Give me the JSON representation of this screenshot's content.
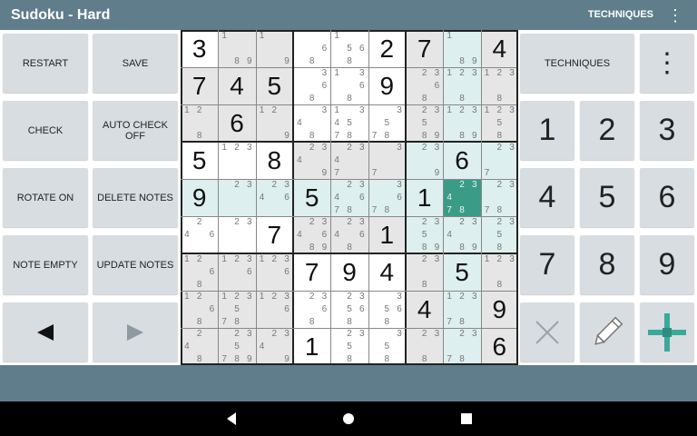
{
  "app": {
    "title": "Sudoku - Hard"
  },
  "topbar": {
    "techniques_label": "TECHNIQUES",
    "menu_icon": "overflow-menu-icon"
  },
  "left_buttons": [
    {
      "label": "RESTART"
    },
    {
      "label": "SAVE"
    },
    {
      "label": "CHECK"
    },
    {
      "label": "AUTO CHECK OFF"
    },
    {
      "label": "ROTATE ON"
    },
    {
      "label": "DELETE NOTES"
    },
    {
      "label": "NOTE EMPTY"
    },
    {
      "label": "UPDATE NOTES"
    }
  ],
  "nav_buttons": {
    "prev_icon": "arrow-left-icon",
    "next_icon": "arrow-right-icon"
  },
  "right_panel": {
    "techniques_label": "TECHNIQUES",
    "menu_icon": "overflow-menu-icon",
    "number_buttons": [
      "1",
      "2",
      "3",
      "4",
      "5",
      "6",
      "7",
      "8",
      "9"
    ],
    "tools": [
      "clear-icon",
      "pencil-icon",
      "crosshair-icon"
    ]
  },
  "colors": {
    "header": "#607d8b",
    "button": "#d7dde0",
    "cell_gray": "#e6e6e6",
    "cell_teal": "#ddefee",
    "cell_selected": "#3a9c86",
    "crosshair": "#3aa99b"
  },
  "grid": {
    "values": [
      [
        "3",
        "",
        "",
        "",
        "",
        "2",
        "7",
        "",
        "4"
      ],
      [
        "7",
        "4",
        "5",
        "",
        "",
        "9",
        "",
        "",
        ""
      ],
      [
        "",
        "6",
        "",
        "",
        "",
        "",
        "",
        "",
        ""
      ],
      [
        "5",
        "",
        "8",
        "",
        "",
        "",
        "",
        "6",
        ""
      ],
      [
        "9",
        "",
        "",
        "5",
        "",
        "",
        "1",
        "",
        ""
      ],
      [
        "",
        "",
        "7",
        "",
        "",
        "1",
        "",
        "",
        ""
      ],
      [
        "",
        "",
        "",
        "7",
        "9",
        "4",
        "",
        "5",
        ""
      ],
      [
        "",
        "",
        "",
        "",
        "",
        "",
        "4",
        "",
        "9"
      ],
      [
        "",
        "",
        "",
        "1",
        "",
        "",
        "",
        "",
        "6"
      ]
    ],
    "notes": [
      [
        [],
        [
          "1",
          "",
          "",
          "",
          "",
          "",
          "",
          "8",
          "9"
        ],
        [
          "1",
          "",
          "",
          "",
          "",
          "",
          "",
          "",
          "9"
        ],
        [
          "",
          "",
          "",
          "",
          "",
          "6",
          "",
          "8",
          ""
        ],
        [
          "1",
          "",
          "",
          "",
          "5",
          "6",
          "",
          "8",
          ""
        ],
        [],
        [],
        [
          "1",
          "",
          "",
          "",
          "",
          "",
          "",
          "8",
          "9"
        ],
        []
      ],
      [
        [],
        [],
        [],
        [
          "",
          "",
          "3",
          "",
          "",
          "6",
          "",
          "8",
          ""
        ],
        [
          "1",
          "",
          "3",
          "",
          "",
          "6",
          "",
          "8",
          ""
        ],
        [],
        [
          "",
          "2",
          "3",
          "",
          "",
          "6",
          "",
          "8",
          ""
        ],
        [
          "1",
          "2",
          "3",
          "",
          "",
          "",
          "",
          "8",
          ""
        ],
        [
          "1",
          "2",
          "3",
          "",
          "",
          "",
          "",
          "8",
          ""
        ]
      ],
      [
        [
          "1",
          "2",
          "",
          "",
          "",
          "",
          "",
          "8",
          ""
        ],
        [],
        [
          "1",
          "2",
          "",
          "",
          "",
          "",
          "",
          "",
          "9"
        ],
        [
          "",
          "",
          "3",
          "4",
          "",
          "",
          "",
          "8",
          ""
        ],
        [
          "1",
          "",
          "3",
          "4",
          "5",
          "",
          "7",
          "8",
          ""
        ],
        [
          "",
          "",
          "3",
          "",
          "5",
          "",
          "7",
          "8",
          ""
        ],
        [
          "",
          "2",
          "3",
          "",
          "5",
          "",
          "",
          "8",
          "9"
        ],
        [
          "1",
          "2",
          "3",
          "",
          "",
          "",
          "",
          "8",
          "9"
        ],
        [
          "1",
          "2",
          "3",
          "",
          "5",
          "",
          "",
          "8",
          ""
        ]
      ],
      [
        [],
        [
          "1",
          "2",
          "3",
          "",
          "",
          "",
          "",
          "",
          ""
        ],
        [],
        [
          "",
          "2",
          "3",
          "4",
          "",
          "",
          "",
          "",
          "9"
        ],
        [
          "",
          "2",
          "3",
          "4",
          "",
          "",
          "7",
          "",
          ""
        ],
        [
          "",
          "",
          "3",
          "",
          "",
          "",
          "7",
          "",
          ""
        ],
        [
          "",
          "2",
          "3",
          "",
          "",
          "",
          "",
          "",
          "9"
        ],
        [],
        [
          "",
          "2",
          "3",
          "",
          "",
          "",
          "7",
          "",
          ""
        ]
      ],
      [
        [],
        [
          "",
          "2",
          "3",
          "",
          "",
          "",
          "",
          "",
          ""
        ],
        [
          "",
          "2",
          "3",
          "4",
          "",
          "6",
          "",
          "",
          ""
        ],
        [],
        [
          "",
          "2",
          "3",
          "4",
          "",
          "6",
          "7",
          "8",
          ""
        ],
        [
          "",
          "",
          "3",
          "",
          "",
          "6",
          "7",
          "8",
          ""
        ],
        [],
        [
          "",
          "2",
          "3",
          "4",
          "",
          "",
          "7",
          "8",
          ""
        ],
        [
          "",
          "2",
          "3",
          "",
          "",
          "",
          "7",
          "8",
          ""
        ]
      ],
      [
        [
          "",
          "2",
          "",
          "4",
          "",
          "6",
          "",
          "",
          ""
        ],
        [
          "",
          "2",
          "3",
          "",
          "",
          "",
          "",
          "",
          ""
        ],
        [],
        [
          "",
          "2",
          "3",
          "4",
          "",
          "6",
          "",
          "8",
          "9"
        ],
        [
          "",
          "2",
          "3",
          "4",
          "",
          "6",
          "",
          "8",
          ""
        ],
        [],
        [
          "",
          "2",
          "3",
          "",
          "5",
          "",
          "",
          "8",
          "9"
        ],
        [
          "",
          "2",
          "3",
          "4",
          "",
          "",
          "",
          "8",
          "9"
        ],
        [
          "",
          "2",
          "3",
          "",
          "5",
          "",
          "",
          "8",
          ""
        ]
      ],
      [
        [
          "1",
          "2",
          "",
          "",
          "",
          "6",
          "",
          "8",
          ""
        ],
        [
          "1",
          "2",
          "3",
          "",
          "",
          "6",
          "",
          "",
          ""
        ],
        [
          "1",
          "2",
          "3",
          "",
          "",
          "6",
          "",
          "",
          ""
        ],
        [],
        [],
        [],
        [
          "",
          "2",
          "3",
          "",
          "",
          "",
          "",
          "8",
          ""
        ],
        [],
        [
          "1",
          "2",
          "3",
          "",
          "",
          "",
          "",
          "8",
          ""
        ]
      ],
      [
        [
          "1",
          "2",
          "",
          "",
          "",
          "6",
          "",
          "8",
          ""
        ],
        [
          "1",
          "2",
          "3",
          "",
          "5",
          "",
          "7",
          "8",
          ""
        ],
        [
          "1",
          "2",
          "3",
          "",
          "",
          "6",
          "",
          "",
          ""
        ],
        [
          "",
          "2",
          "3",
          "",
          "",
          "6",
          "",
          "8",
          ""
        ],
        [
          "",
          "2",
          "3",
          "",
          "5",
          "6",
          "",
          "8",
          ""
        ],
        [
          "",
          "",
          "3",
          "",
          "5",
          "6",
          "",
          "8",
          ""
        ],
        [],
        [
          "1",
          "2",
          "3",
          "",
          "",
          "",
          "7",
          "8",
          ""
        ],
        []
      ],
      [
        [
          "",
          "2",
          "",
          "4",
          "",
          "",
          "",
          "8",
          ""
        ],
        [
          "",
          "2",
          "3",
          "",
          "5",
          "",
          "7",
          "8",
          "9"
        ],
        [
          "",
          "2",
          "3",
          "4",
          "",
          "",
          "",
          "",
          "9"
        ],
        [],
        [
          "",
          "2",
          "3",
          "",
          "5",
          "",
          "",
          "8",
          ""
        ],
        [
          "",
          "",
          "3",
          "",
          "5",
          "",
          "",
          "8",
          ""
        ],
        [
          "",
          "2",
          "3",
          "",
          "",
          "",
          "",
          "8",
          ""
        ],
        [
          "",
          "2",
          "3",
          "",
          "",
          "",
          "7",
          "8",
          ""
        ],
        []
      ]
    ],
    "shade": [
      [
        "w",
        "g",
        "g",
        "w",
        "w",
        "w",
        "g",
        "t",
        "g"
      ],
      [
        "g",
        "g",
        "g",
        "w",
        "w",
        "w",
        "g",
        "t",
        "g"
      ],
      [
        "g",
        "g",
        "g",
        "w",
        "w",
        "w",
        "g",
        "t",
        "g"
      ],
      [
        "w",
        "w",
        "w",
        "g",
        "g",
        "g",
        "t",
        "t",
        "t"
      ],
      [
        "t",
        "t",
        "t",
        "t",
        "t",
        "t",
        "t",
        "s",
        "t"
      ],
      [
        "w",
        "w",
        "w",
        "g",
        "g",
        "g",
        "t",
        "t",
        "t"
      ],
      [
        "g",
        "g",
        "g",
        "w",
        "w",
        "w",
        "g",
        "t",
        "g"
      ],
      [
        "g",
        "g",
        "g",
        "w",
        "w",
        "w",
        "g",
        "t",
        "g"
      ],
      [
        "g",
        "g",
        "g",
        "w",
        "w",
        "w",
        "g",
        "t",
        "g"
      ]
    ]
  },
  "navbar": {
    "back_icon": "back-triangle-icon",
    "home_icon": "home-circle-icon",
    "recents_icon": "recents-square-icon"
  }
}
